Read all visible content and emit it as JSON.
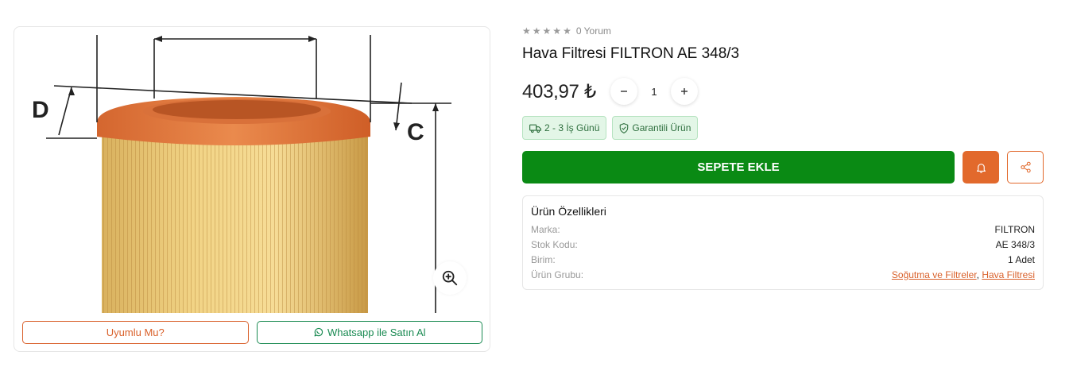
{
  "product": {
    "title": "Hava Filtresi FILTRON AE 348/3",
    "rating_stars": 5,
    "review_text": "0 Yorum",
    "price": "403,97 ₺",
    "quantity": "1",
    "image": {
      "label_d": "D",
      "label_c": "C"
    }
  },
  "image_card": {
    "uyumlu_label": "Uyumlu Mu?",
    "whatsapp_label": "Whatsapp ile Satın Al"
  },
  "badges": {
    "delivery": "2 - 3 İş Günü",
    "warranty": "Garantili Ürün"
  },
  "actions": {
    "add_to_cart": "SEPETE EKLE"
  },
  "specs": {
    "title": "Ürün Özellikleri",
    "marka_label": "Marka:",
    "marka_value": "FILTRON",
    "stok_label": "Stok Kodu:",
    "stok_value": "AE 348/3",
    "birim_label": "Birim:",
    "birim_value": "1 Adet",
    "grup_label": "Ürün Grubu:",
    "grup_link1": "Soğutma ve Filtreler",
    "grup_sep": ",",
    "grup_link2": "Hava Filtresi"
  },
  "colors": {
    "cart_green": "#0a8a14",
    "accent_orange": "#e2692c",
    "whatsapp_green": "#1a8a52"
  },
  "icons": {
    "zoom": "zoom-in-icon",
    "delivery": "truck-icon",
    "warranty": "shield-check-icon",
    "whatsapp": "whatsapp-icon",
    "bell": "bell-icon",
    "share": "share-icon"
  }
}
